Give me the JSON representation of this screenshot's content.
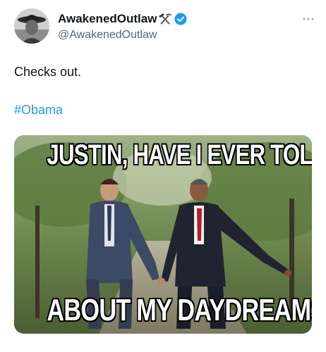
{
  "tweet": {
    "author": {
      "display_name": "AwakenedOutlaw",
      "handle": "@AwakenedOutlaw",
      "name_emoji": "hammer-and-pick-icon",
      "verified": true,
      "avatar": "cowboy-avatar"
    },
    "text": "Checks out.",
    "hashtag": "#Obama",
    "media": {
      "type": "meme-photo",
      "caption_top": "JUSTIN, HAVE I EVER TOLD YOU",
      "caption_bottom": "ABOUT MY DAYDREAMS?"
    }
  },
  "colors": {
    "verified": "#1d9bf0",
    "hashtag": "#1d9bf0",
    "secondary_text": "#536471"
  }
}
